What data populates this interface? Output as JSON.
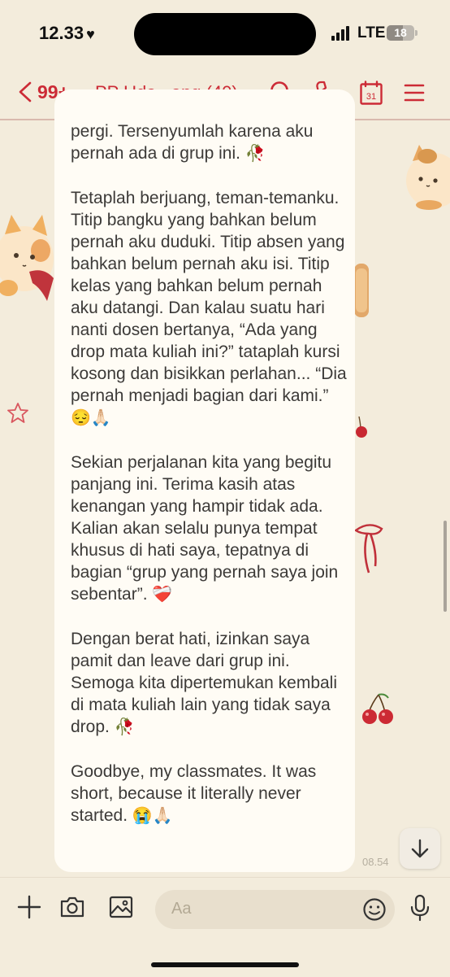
{
  "status_bar": {
    "time": "12.33",
    "network": "LTE",
    "battery": "18"
  },
  "header": {
    "unread_count": "99+",
    "chat_title": "PP Uda...ang (40)",
    "calendar_day": "31"
  },
  "message": {
    "paragraphs": [
      {
        "text": "pergi. Tersenyumlah karena aku pernah ada di grup ini.",
        "emoji": "🥀"
      },
      {
        "text": "Tetaplah berjuang, teman-temanku. Titip bangku yang bahkan belum pernah aku duduki. Titip absen yang bahkan belum pernah aku isi. Titip kelas yang bahkan belum pernah aku datangi. Dan kalau suatu hari nanti dosen bertanya, “Ada yang drop mata kuliah ini?” tataplah kursi kosong dan bisikkan perlahan... “Dia pernah menjadi bagian dari kami.”",
        "emoji": "😔🙏🏻"
      },
      {
        "text": "Sekian perjalanan kita yang begitu panjang ini. Terima kasih atas kenangan yang hampir tidak ada. Kalian akan selalu punya tempat khusus di hati saya, tepatnya di bagian “grup yang pernah saya join sebentar”.",
        "emoji": "❤️‍🩹"
      },
      {
        "text": "Dengan berat hati, izinkan saya pamit dan leave dari grup ini. Semoga kita dipertemukan kembali di mata kuliah lain yang tidak saya drop.",
        "emoji": "🥀"
      },
      {
        "text": "Goodbye, my classmates. It was short, because it literally never started.",
        "emoji": "😭🙏🏻"
      }
    ],
    "time": "08.54"
  },
  "input": {
    "placeholder": "Aa"
  },
  "colors": {
    "accent": "#cc2b36",
    "background": "#f3ecdc",
    "bubble": "#fffcf5"
  }
}
